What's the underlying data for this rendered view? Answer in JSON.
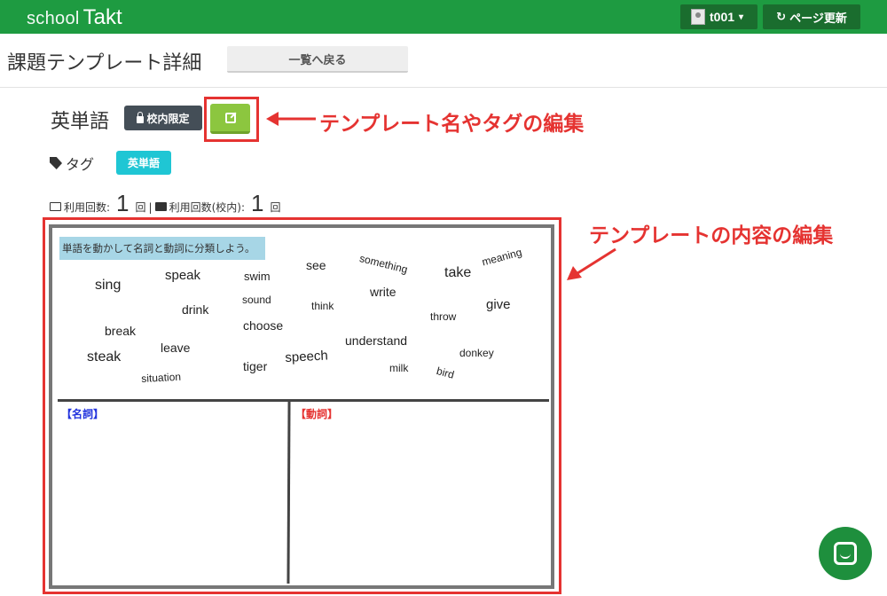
{
  "navbar": {
    "logo_school": "school",
    "logo_takt": "Takt",
    "user_label": "t001",
    "refresh_label": "ページ更新",
    "colors": {
      "bar": "#1e9b41",
      "button": "#1a6d2e"
    }
  },
  "header": {
    "title": "課題テンプレート詳細",
    "back_label": "一覧へ戻る"
  },
  "template": {
    "name": "英単語",
    "scope_badge": "校内限定",
    "tag_label": "タグ",
    "tags": [
      "英単語"
    ],
    "usage_label": "利用回数:",
    "usage_count": "1",
    "usage_unit": "回",
    "separator": "|",
    "school_usage_label": "利用回数(校内):",
    "school_usage_count": "1",
    "school_usage_unit": "回"
  },
  "annotations": {
    "edit_name_tags": "テンプレート名やタグの編集",
    "edit_content": "テンプレートの内容の編集",
    "color": "#e53331"
  },
  "board": {
    "instruction": "単語を動かして名詞と動詞に分類しよう。",
    "noun_label": "【名詞】",
    "verb_label": "【動詞】",
    "words": [
      "sing",
      "speak",
      "swim",
      "see",
      "something",
      "take",
      "meaning",
      "drink",
      "sound",
      "think",
      "write",
      "throw",
      "give",
      "break",
      "leave",
      "choose",
      "understand",
      "steak",
      "speech",
      "tiger",
      "milk",
      "donkey",
      "situation",
      "bird"
    ]
  }
}
